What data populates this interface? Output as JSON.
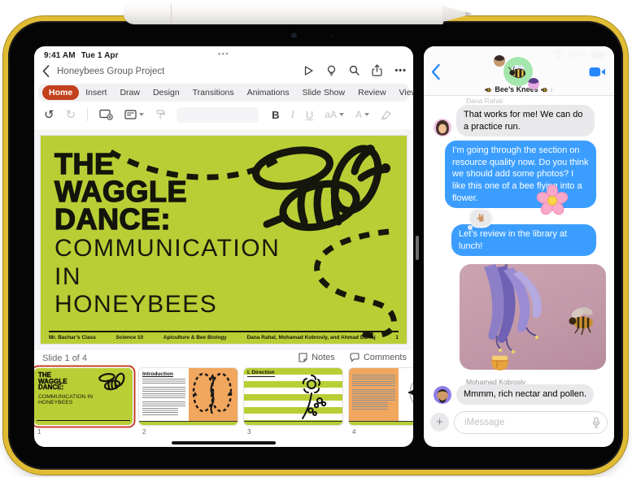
{
  "left_app": {
    "status": {
      "time": "9:41 AM",
      "date": "Tue 1 Apr",
      "window_dots": "•••"
    },
    "nav": {
      "title": "Honeybees Group Project",
      "more": "•••"
    },
    "tabs": [
      {
        "label": "Home",
        "selected": true
      },
      {
        "label": "Insert"
      },
      {
        "label": "Draw"
      },
      {
        "label": "Design"
      },
      {
        "label": "Transitions"
      },
      {
        "label": "Animations"
      },
      {
        "label": "Slide Show"
      },
      {
        "label": "Review"
      },
      {
        "label": "View"
      }
    ],
    "toolbar": {
      "undo": "↺",
      "redo": "↻",
      "bold": "B",
      "italic": "I",
      "underline": "U",
      "text_size": "aA",
      "font_color": "A"
    },
    "slide": {
      "title_lines": [
        "THE",
        "WAGGLE",
        "DANCE:"
      ],
      "subtitle_lines": [
        "COMMUNICATION",
        "IN",
        "HONEYBEES"
      ],
      "footer": {
        "teacher": "Mr. Bachar’s Class",
        "course": "Science 10",
        "unit": "Apiculture & Bee Biology",
        "authors": "Dana Rahal, Mohamad Kobrosly, and Ahmad Darraj",
        "page": "1"
      }
    },
    "status_row": {
      "slide_label": "Slide 1 of 4",
      "notes": "Notes",
      "comments": "Comments"
    },
    "thumbnails": [
      {
        "num": "1"
      },
      {
        "num": "2",
        "heading": "Introduction"
      },
      {
        "num": "3",
        "heading": "I. Direction"
      },
      {
        "num": "4"
      }
    ]
  },
  "right_app": {
    "status": {
      "window_dots": "•••",
      "battery": "100%"
    },
    "header": {
      "group_name": "Bee’s Knees",
      "chevron": "›"
    },
    "messages": {
      "label1": "Dana Rahal",
      "m1": "That works for me! We can do a practice run.",
      "m2": "I’m going through the section on resource quality now. Do you think we should add some photos? I like this one of a bee flying into a flower.",
      "m3": "Let’s review in the library at lunch!",
      "label2": "Mohamad Kobrosly",
      "m4": "Mmmm, rich nectar and pollen."
    },
    "input": {
      "placeholder": "iMessage",
      "plus": "+"
    }
  },
  "icons": {
    "left_nav": [
      "play",
      "lightbulb",
      "search",
      "share",
      "more"
    ],
    "left_toolbar": [
      "undo",
      "redo",
      "new-slide",
      "layout",
      "format-painter",
      "bold",
      "italic",
      "underline",
      "text-size",
      "font-color",
      "highlighter"
    ],
    "right_app": [
      "back-chevron",
      "video-camera",
      "wifi",
      "battery",
      "plus",
      "microphone"
    ],
    "stickers": {
      "flower": "🌸",
      "honey_pot": "🍯",
      "tapback": "🤟",
      "bee": "🐝"
    }
  },
  "colors": {
    "powerpoint_red": "#c3411d",
    "slide_green": "#b9ce35",
    "imessage_blue": "#3b9eff",
    "bubble_gray": "#e9e9eb",
    "ipad_yellow": "#e0bc35",
    "avatar_green": "#a4e6ab"
  }
}
